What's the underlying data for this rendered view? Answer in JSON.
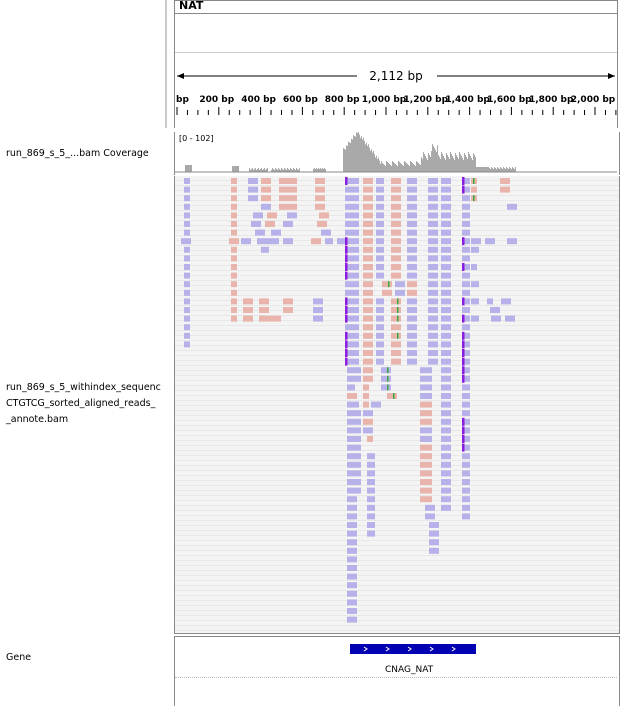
{
  "header": {
    "locus_name": "NAT",
    "span_label": "2,112 bp",
    "ruler_ticks": [
      "bp",
      "200 bp",
      "400 bp",
      "600 bp",
      "800 bp",
      "1,000 bp",
      "1,200 bp",
      "1,400 bp",
      "1,600 bp",
      "1,800 bp",
      "2,000 bp"
    ]
  },
  "tracks": {
    "coverage": {
      "name": "run_869_s_5_...bam Coverage",
      "range": "[0 - 102]"
    },
    "alignments": {
      "name_lines": [
        "run_869_s_5_withindex_sequenc",
        "CTGTCG_sorted_aligned_reads_",
        "_annote.bam"
      ]
    },
    "gene": {
      "name": "Gene",
      "feature_label": "CNAG_NAT"
    }
  },
  "colors": {
    "forward_read": "#e8b4ab",
    "reverse_read": "#b7b1ea",
    "coverage_bar": "#a9a9a9",
    "gene_feature": "#0000b2",
    "insertion_marker": "#8a1de0",
    "mismatch_green": "#3aa83a"
  }
}
